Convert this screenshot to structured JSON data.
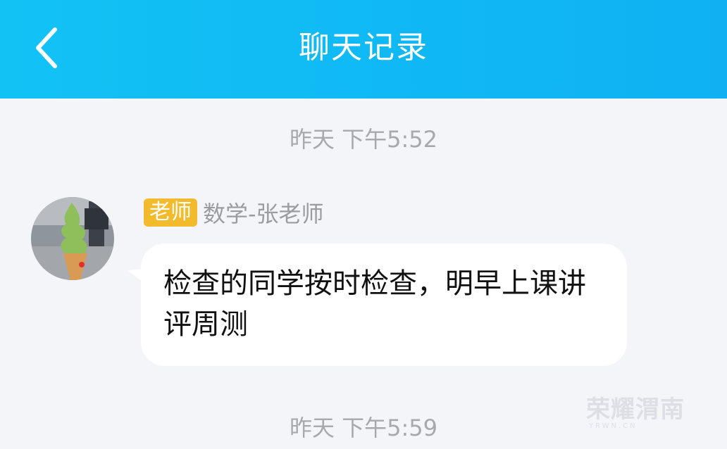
{
  "header": {
    "title": "聊天记录",
    "back_icon": "chevron-left-icon",
    "background": "#12c2f5"
  },
  "messages": [
    {
      "timestamp": "昨天 下午5:52",
      "sender_role": "老师",
      "sender_name": "数学-张老师",
      "avatar_icon": "ice-cream-avatar",
      "text": "检查的同学按时检查，明早上课讲评周测"
    }
  ],
  "next_timestamp": "昨天 下午5:59",
  "watermark": {
    "text": "荣耀渭南",
    "subtext": "YRWN.CN"
  },
  "colors": {
    "badge": "#f2bb2d",
    "timestamp": "#a8a8ad",
    "page_background": "#f4f5f9"
  }
}
